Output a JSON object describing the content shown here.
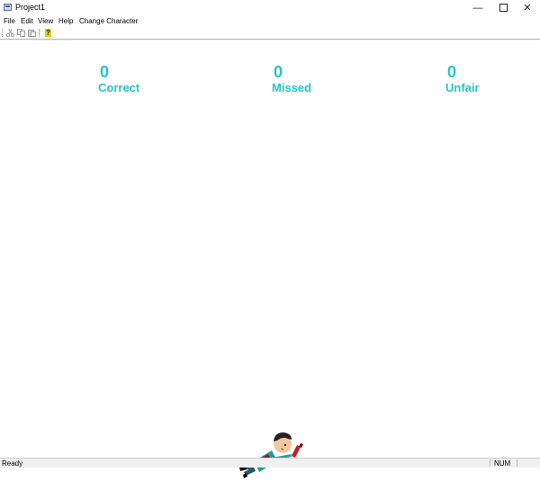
{
  "window": {
    "title": "Project1",
    "minimize_glyph": "—",
    "close_glyph": "✕"
  },
  "menu": {
    "items": [
      "File",
      "Edit",
      "View",
      "Help",
      "Change Character"
    ]
  },
  "toolbar": {
    "cut_icon": "scissors-icon",
    "copy_icon": "copy-icon",
    "paste_icon": "paste-icon",
    "about_icon": "help-question-icon",
    "about_glyph": "?"
  },
  "scores": {
    "correct": {
      "value": "0",
      "label": "Correct"
    },
    "missed": {
      "value": "0",
      "label": "Missed"
    },
    "unfair": {
      "value": "0",
      "label": "Unfair"
    },
    "color": "#26c6c2"
  },
  "character": {
    "icon": "fallen-character-sprite"
  },
  "status": {
    "text": "Ready",
    "num": "NUM"
  }
}
